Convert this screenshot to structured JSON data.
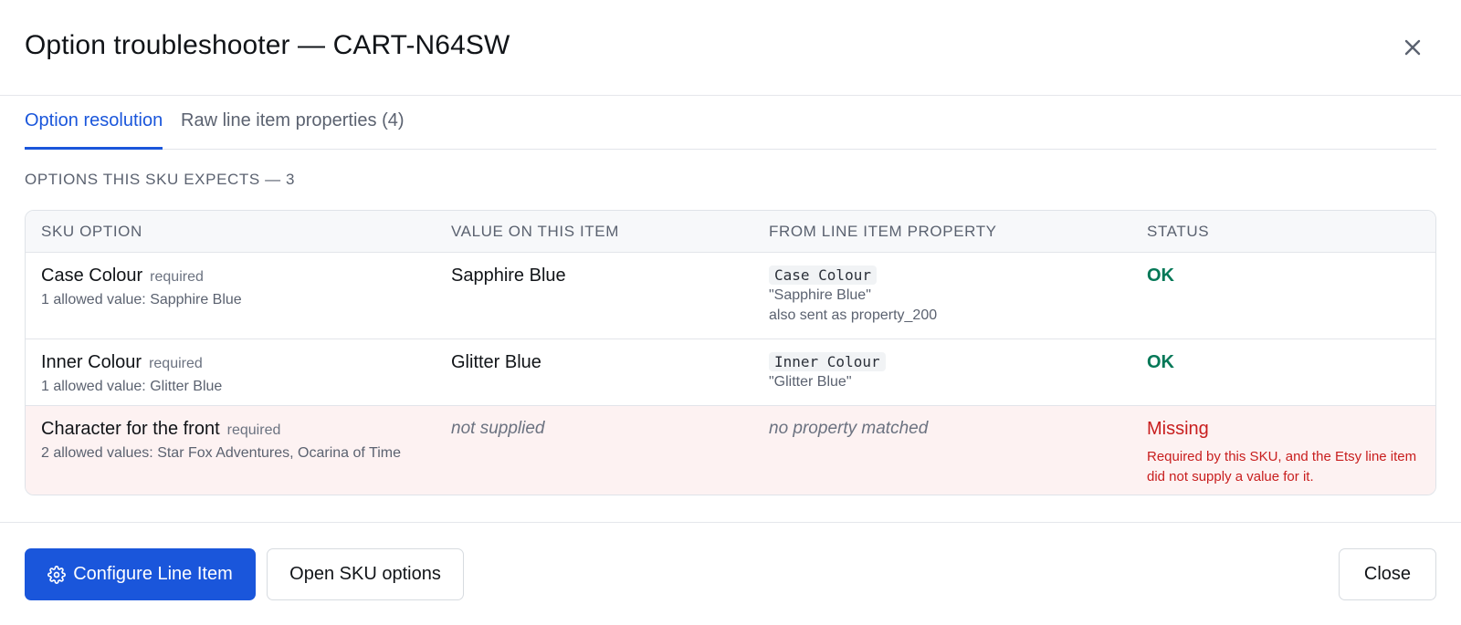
{
  "dialog": {
    "title": "Option troubleshooter — CART-N64SW"
  },
  "tabs": [
    {
      "label": "Option resolution",
      "active": true
    },
    {
      "label": "Raw line item properties (4)",
      "active": false
    }
  ],
  "section": {
    "label": "OPTIONS THIS SKU EXPECTS — 3"
  },
  "table": {
    "headers": [
      "SKU OPTION",
      "VALUE ON THIS ITEM",
      "FROM LINE ITEM PROPERTY",
      "STATUS"
    ],
    "rows": [
      {
        "option": "Case Colour",
        "required": "required",
        "allowed": "1 allowed value: Sapphire Blue",
        "value": "Sapphire Blue",
        "property": "Case Colour",
        "property_value": "\"Sapphire Blue\"",
        "property_note": "also sent as property_200",
        "status": "OK"
      },
      {
        "option": "Inner Colour",
        "required": "required",
        "allowed": "1 allowed value: Glitter Blue",
        "value": "Glitter Blue",
        "property": "Inner Colour",
        "property_value": "\"Glitter Blue\"",
        "status": "OK"
      },
      {
        "option": "Character for the front",
        "required": "required",
        "allowed": "2 allowed values: Star Fox Adventures, Ocarina of Time",
        "value": "not supplied",
        "property": "no property matched",
        "status": "Missing",
        "status_note": "Required by this SKU, and the Etsy line item did not supply a value for it."
      }
    ]
  },
  "footer": {
    "configure_label": "Configure Line Item",
    "open_sku_label": "Open SKU options",
    "close_label": "Close"
  },
  "colors": {
    "accent": "#1a56db",
    "ok": "#047857",
    "missing": "#c81e1e",
    "missing_row_bg": "#fdf2f2"
  },
  "icons": {
    "close": "close-icon",
    "configure": "gear-icon"
  }
}
